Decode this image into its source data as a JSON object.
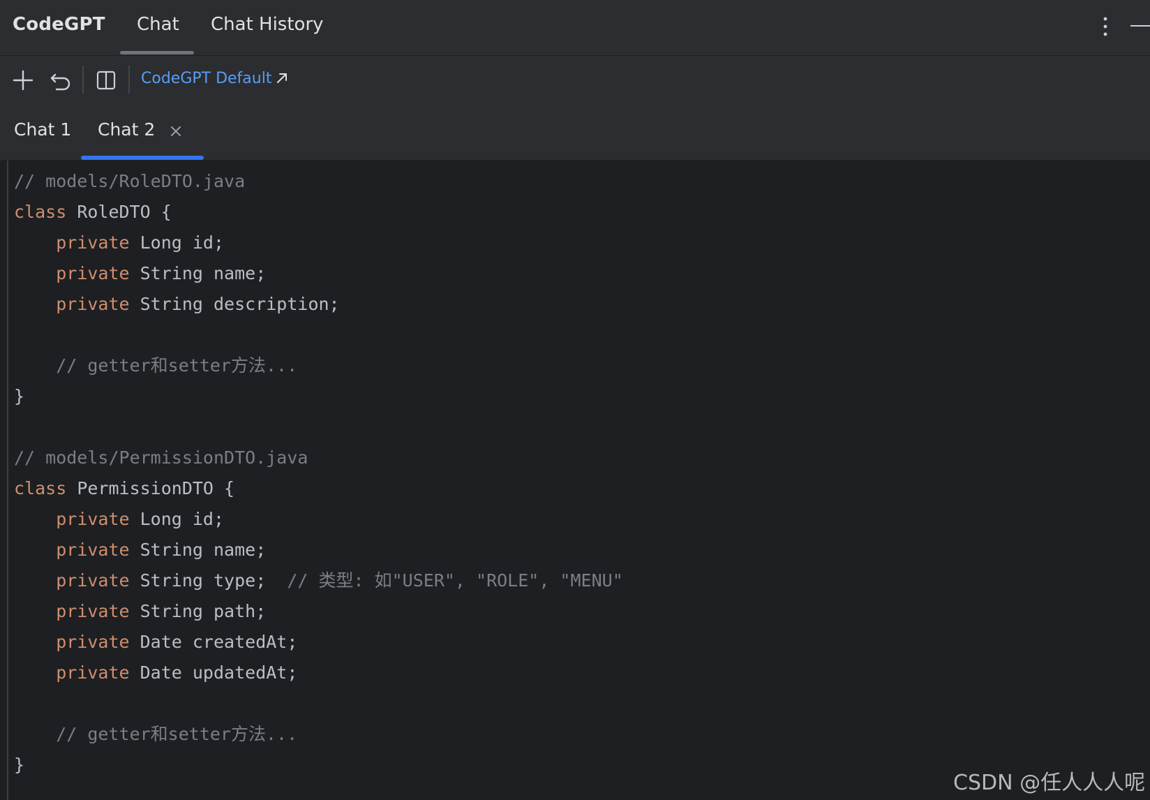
{
  "header": {
    "brand": "CodeGPT",
    "tabs": [
      {
        "label": "Chat",
        "active": true
      },
      {
        "label": "Chat History",
        "active": false
      }
    ]
  },
  "toolbar": {
    "model_link": "CodeGPT Default",
    "icons": [
      "plus-icon",
      "undo-icon",
      "split-panel-icon",
      "external-link-icon"
    ]
  },
  "chat_tabs": [
    {
      "label": "Chat 1",
      "active": false
    },
    {
      "label": "Chat 2",
      "active": true,
      "closable": true
    }
  ],
  "colors": {
    "accent": "#3574f0",
    "link": "#589df6",
    "keyword": "#cf8e6d",
    "comment": "#7a7e85",
    "text": "#bcbec4",
    "background": "#1e1f22",
    "panel": "#2b2d30"
  },
  "code": {
    "lines": [
      [
        {
          "t": "cm",
          "v": "// models/RoleDTO.java"
        }
      ],
      [
        {
          "t": "kw",
          "v": "class"
        },
        {
          "t": "tx",
          "v": " RoleDTO {"
        }
      ],
      [
        {
          "t": "tx",
          "v": "    "
        },
        {
          "t": "kw",
          "v": "private"
        },
        {
          "t": "tx",
          "v": " Long id;"
        }
      ],
      [
        {
          "t": "tx",
          "v": "    "
        },
        {
          "t": "kw",
          "v": "private"
        },
        {
          "t": "tx",
          "v": " String name;"
        }
      ],
      [
        {
          "t": "tx",
          "v": "    "
        },
        {
          "t": "kw",
          "v": "private"
        },
        {
          "t": "tx",
          "v": " String description;"
        }
      ],
      [
        {
          "t": "tx",
          "v": ""
        }
      ],
      [
        {
          "t": "tx",
          "v": "    "
        },
        {
          "t": "cm",
          "v": "// getter和setter方法..."
        }
      ],
      [
        {
          "t": "tx",
          "v": "}"
        }
      ],
      [
        {
          "t": "tx",
          "v": ""
        }
      ],
      [
        {
          "t": "cm",
          "v": "// models/PermissionDTO.java"
        }
      ],
      [
        {
          "t": "kw",
          "v": "class"
        },
        {
          "t": "tx",
          "v": " PermissionDTO {"
        }
      ],
      [
        {
          "t": "tx",
          "v": "    "
        },
        {
          "t": "kw",
          "v": "private"
        },
        {
          "t": "tx",
          "v": " Long id;"
        }
      ],
      [
        {
          "t": "tx",
          "v": "    "
        },
        {
          "t": "kw",
          "v": "private"
        },
        {
          "t": "tx",
          "v": " String name;"
        }
      ],
      [
        {
          "t": "tx",
          "v": "    "
        },
        {
          "t": "kw",
          "v": "private"
        },
        {
          "t": "tx",
          "v": " String type;  "
        },
        {
          "t": "cm",
          "v": "// 类型: 如\"USER\", \"ROLE\", \"MENU\""
        }
      ],
      [
        {
          "t": "tx",
          "v": "    "
        },
        {
          "t": "kw",
          "v": "private"
        },
        {
          "t": "tx",
          "v": " String path;"
        }
      ],
      [
        {
          "t": "tx",
          "v": "    "
        },
        {
          "t": "kw",
          "v": "private"
        },
        {
          "t": "tx",
          "v": " Date createdAt;"
        }
      ],
      [
        {
          "t": "tx",
          "v": "    "
        },
        {
          "t": "kw",
          "v": "private"
        },
        {
          "t": "tx",
          "v": " Date updatedAt;"
        }
      ],
      [
        {
          "t": "tx",
          "v": ""
        }
      ],
      [
        {
          "t": "tx",
          "v": "    "
        },
        {
          "t": "cm",
          "v": "// getter和setter方法..."
        }
      ],
      [
        {
          "t": "tx",
          "v": "}"
        }
      ]
    ]
  },
  "watermark": "CSDN @任人人人呢"
}
